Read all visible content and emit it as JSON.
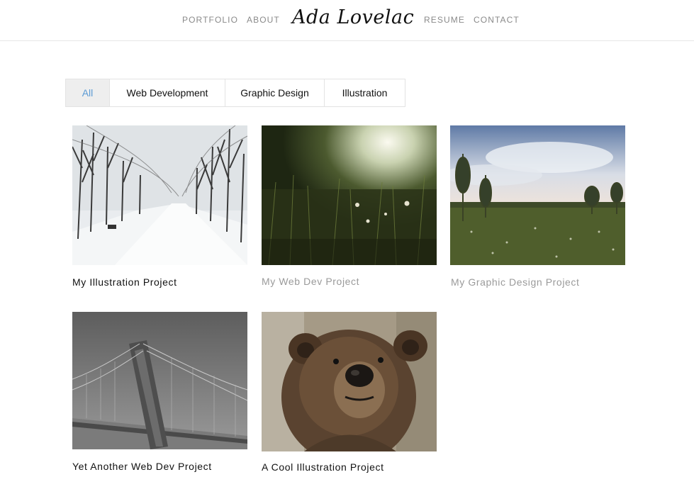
{
  "nav": {
    "left_links": [
      "PORTFOLIO",
      "ABOUT"
    ],
    "logo_text": "Ada Lovelace",
    "right_links": [
      "RESUME",
      "CONTACT"
    ]
  },
  "filters": {
    "tabs": [
      {
        "label": "All",
        "active": true
      },
      {
        "label": "Web Development",
        "active": false
      },
      {
        "label": "Graphic Design",
        "active": false
      },
      {
        "label": "Illustration",
        "active": false
      }
    ],
    "active_color": "#5b9bd5"
  },
  "projects": [
    {
      "title": "My Illustration Project",
      "image": "snowy-forest-road",
      "muted": false
    },
    {
      "title": "My Web Dev Project",
      "image": "sunlit-meadow",
      "muted": true
    },
    {
      "title": "My Graphic Design Project",
      "image": "marsh-landscape",
      "muted": true
    },
    {
      "title": "Yet Another Web Dev Project",
      "image": "suspension-bridge-aerial",
      "muted": false
    },
    {
      "title": "A Cool Illustration Project",
      "image": "brown-bear-portrait",
      "muted": false
    }
  ],
  "colors": {
    "nav_text": "#8a8a8a",
    "muted_title": "#9a9a9a",
    "border": "#e3e3e3"
  }
}
